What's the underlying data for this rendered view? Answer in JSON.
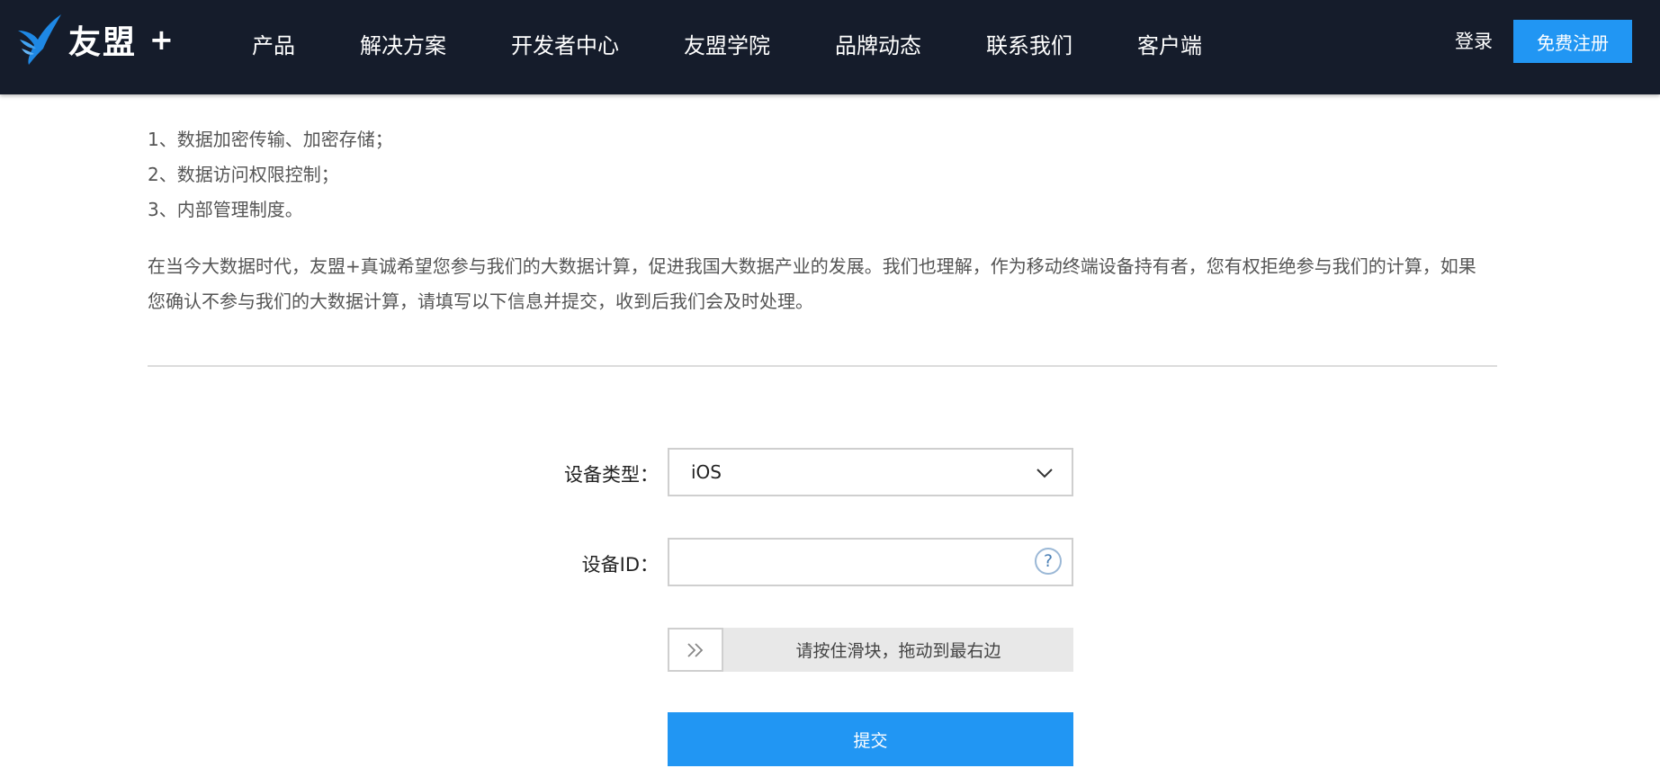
{
  "header": {
    "logo": {
      "text": "友盟",
      "plus": "+",
      "icon": "hummingbird-logo-icon"
    },
    "nav": [
      "产品",
      "解决方案",
      "开发者中心",
      "友盟学院",
      "品牌动态",
      "联系我们",
      "客户端"
    ],
    "login_label": "登录",
    "register_label": "免费注册"
  },
  "content": {
    "list": [
      "1、数据加密传输、加密存储；",
      "2、数据访问权限控制；",
      "3、内部管理制度。"
    ],
    "paragraph": "在当今大数据时代，友盟+真诚希望您参与我们的大数据计算，促进我国大数据产业的发展。我们也理解，作为移动终端设备持有者，您有权拒绝参与我们的计算，如果您确认不参与我们的大数据计算，请填写以下信息并提交，收到后我们会及时处理。"
  },
  "form": {
    "device_type_label": "设备类型：",
    "device_type_value": "iOS",
    "device_id_label": "设备ID：",
    "device_id_value": "",
    "help_symbol": "?",
    "slider_text": "请按住滑块，拖动到最右边",
    "submit_label": "提交"
  },
  "colors": {
    "header_bg": "#151c2b",
    "accent": "#2196f3",
    "logo_blue": "#1e88e5"
  }
}
